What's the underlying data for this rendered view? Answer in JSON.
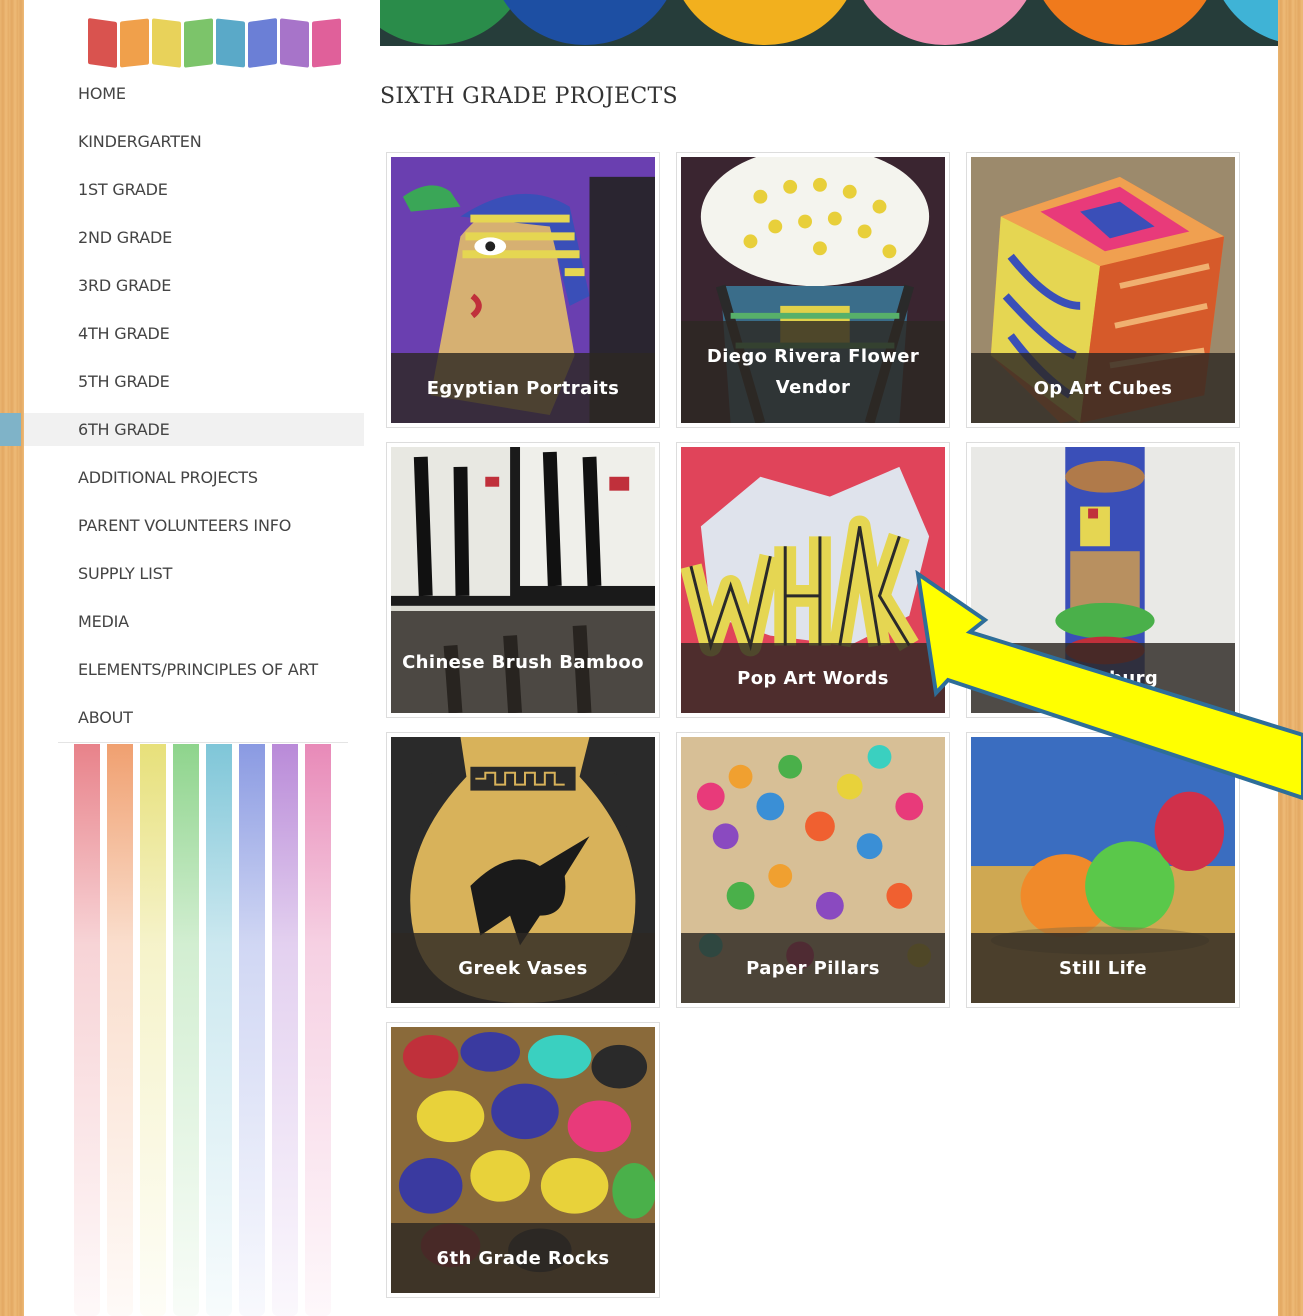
{
  "nav": {
    "items": [
      {
        "label": "HOME"
      },
      {
        "label": "KINDERGARTEN"
      },
      {
        "label": "1ST GRADE"
      },
      {
        "label": "2ND GRADE"
      },
      {
        "label": "3RD GRADE"
      },
      {
        "label": "4TH GRADE"
      },
      {
        "label": "5TH GRADE"
      },
      {
        "label": "6TH GRADE"
      },
      {
        "label": "ADDITIONAL PROJECTS"
      },
      {
        "label": "PARENT VOLUNTEERS INFO"
      },
      {
        "label": "SUPPLY LIST"
      },
      {
        "label": "MEDIA"
      },
      {
        "label": "ELEMENTS/PRINCIPLES OF ART"
      },
      {
        "label": "ABOUT"
      }
    ],
    "active": "6TH GRADE",
    "active_color": "#7fb3c8"
  },
  "main": {
    "title": "SIXTH GRADE PROJECTS",
    "projects": [
      {
        "title": "Egyptian Portraits"
      },
      {
        "title": "Diego Rivera Flower Vendor"
      },
      {
        "title": "Op Art Cubes"
      },
      {
        "title": "Chinese Brush Bamboo"
      },
      {
        "title": "Pop Art Words"
      },
      {
        "title": "Oldenburg"
      },
      {
        "title": "Greek Vases"
      },
      {
        "title": "Paper Pillars"
      },
      {
        "title": "Still Life"
      },
      {
        "title": "6th Grade Rocks"
      }
    ]
  },
  "annotation": {
    "arrow_color": "#ffff00",
    "arrow_outline": "#2e6e99"
  }
}
